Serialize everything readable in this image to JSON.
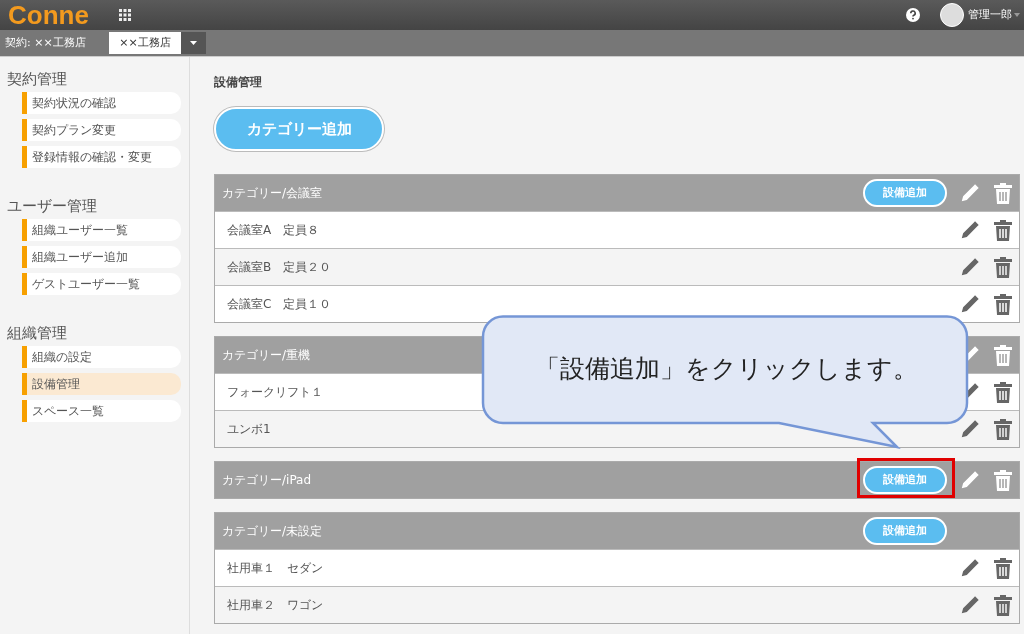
{
  "header": {
    "logo": "Conne",
    "user_name": "管理一郎"
  },
  "contract_bar": {
    "label": "契約: ××工務店",
    "selected_company": "××工務店"
  },
  "sidebar": [
    {
      "title": "契約管理",
      "items": [
        {
          "label": "契約状況の確認",
          "selected": false
        },
        {
          "label": "契約プラン変更",
          "selected": false
        },
        {
          "label": "登録情報の確認・変更",
          "selected": false
        }
      ]
    },
    {
      "title": "ユーザー管理",
      "items": [
        {
          "label": "組織ユーザー一覧",
          "selected": false
        },
        {
          "label": "組織ユーザー追加",
          "selected": false
        },
        {
          "label": "ゲストユーザー一覧",
          "selected": false
        }
      ]
    },
    {
      "title": "組織管理",
      "items": [
        {
          "label": "組織の設定",
          "selected": false
        },
        {
          "label": "設備管理",
          "selected": true
        },
        {
          "label": "スペース一覧",
          "selected": false
        }
      ]
    }
  ],
  "main": {
    "title": "設備管理",
    "add_category_button": "カテゴリー追加",
    "categories": [
      {
        "name": "カテゴリー/会議室",
        "add_button": "設備追加",
        "editable": true,
        "highlighted": false,
        "items": [
          "会議室A　定員８",
          "会議室B　定員２０",
          "会議室C　定員１０"
        ]
      },
      {
        "name": "カテゴリー/重機",
        "editable": true,
        "highlighted": false,
        "items": [
          "フォークリフト１",
          "ユンボ1"
        ]
      },
      {
        "name": "カテゴリー/iPad",
        "add_button": "設備追加",
        "editable": true,
        "highlighted": true
      },
      {
        "name": "カテゴリー/未設定",
        "add_button": "設備追加",
        "editable": false,
        "highlighted": false,
        "items": [
          "社用車１　セダン",
          "社用車２　ワゴン"
        ]
      }
    ]
  },
  "callout": {
    "text": "「設備追加」をクリックします。"
  }
}
